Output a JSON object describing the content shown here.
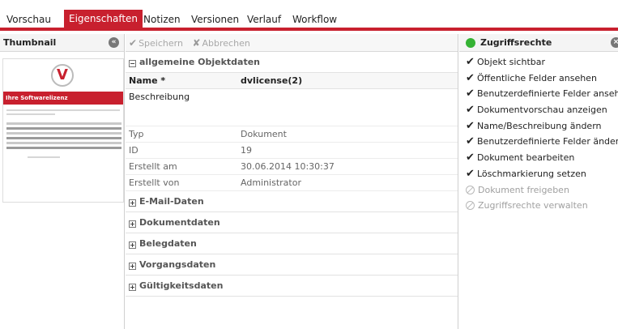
{
  "tabs": [
    {
      "label": "Vorschau",
      "active": false
    },
    {
      "label": "Eigenschaften",
      "active": true
    },
    {
      "label": "Notizen",
      "active": false
    },
    {
      "label": "Versionen",
      "active": false
    },
    {
      "label": "Verlauf",
      "active": false
    },
    {
      "label": "Workflow",
      "active": false
    }
  ],
  "thumbnail": {
    "title": "Thumbnail",
    "collapse_icon": "double-chevron-left-icon",
    "preview_heading": "Ihre Softwarelizenz",
    "preview_logo_letter": "V"
  },
  "toolbar": {
    "save_label": "Speichern",
    "cancel_label": "Abbrechen"
  },
  "general": {
    "section_label": "allgemeine Objektdaten",
    "name_label": "Name *",
    "name_value": "dvlicense(2)",
    "description_label": "Beschreibung",
    "rows": [
      {
        "label": "Typ",
        "value": "Dokument"
      },
      {
        "label": "ID",
        "value": "19"
      },
      {
        "label": "Erstellt am",
        "value": "30.06.2014 10:30:37"
      },
      {
        "label": "Erstellt von",
        "value": "Administrator"
      }
    ]
  },
  "sections": [
    "E-Mail-Daten",
    "Dokumentdaten",
    "Belegdaten",
    "Vorgangsdaten",
    "Gültigkeitsdaten"
  ],
  "permissions": {
    "title": "Zugriffsrechte",
    "items": [
      {
        "label": "Objekt sichtbar",
        "granted": true
      },
      {
        "label": "Öffentliche Felder ansehen",
        "granted": true
      },
      {
        "label": "Benutzerdefinierte Felder ansehen",
        "granted": true
      },
      {
        "label": "Dokumentvorschau anzeigen",
        "granted": true
      },
      {
        "label": "Name/Beschreibung ändern",
        "granted": true
      },
      {
        "label": "Benutzerdefinierte Felder ändern",
        "granted": true
      },
      {
        "label": "Dokument bearbeiten",
        "granted": true
      },
      {
        "label": "Löschmarkierung setzen",
        "granted": true
      },
      {
        "label": "Dokument freigeben",
        "granted": false
      },
      {
        "label": "Zugriffsrechte verwalten",
        "granted": false
      }
    ]
  },
  "colors": {
    "accent": "#c8202e",
    "status_ok": "#34b233"
  }
}
